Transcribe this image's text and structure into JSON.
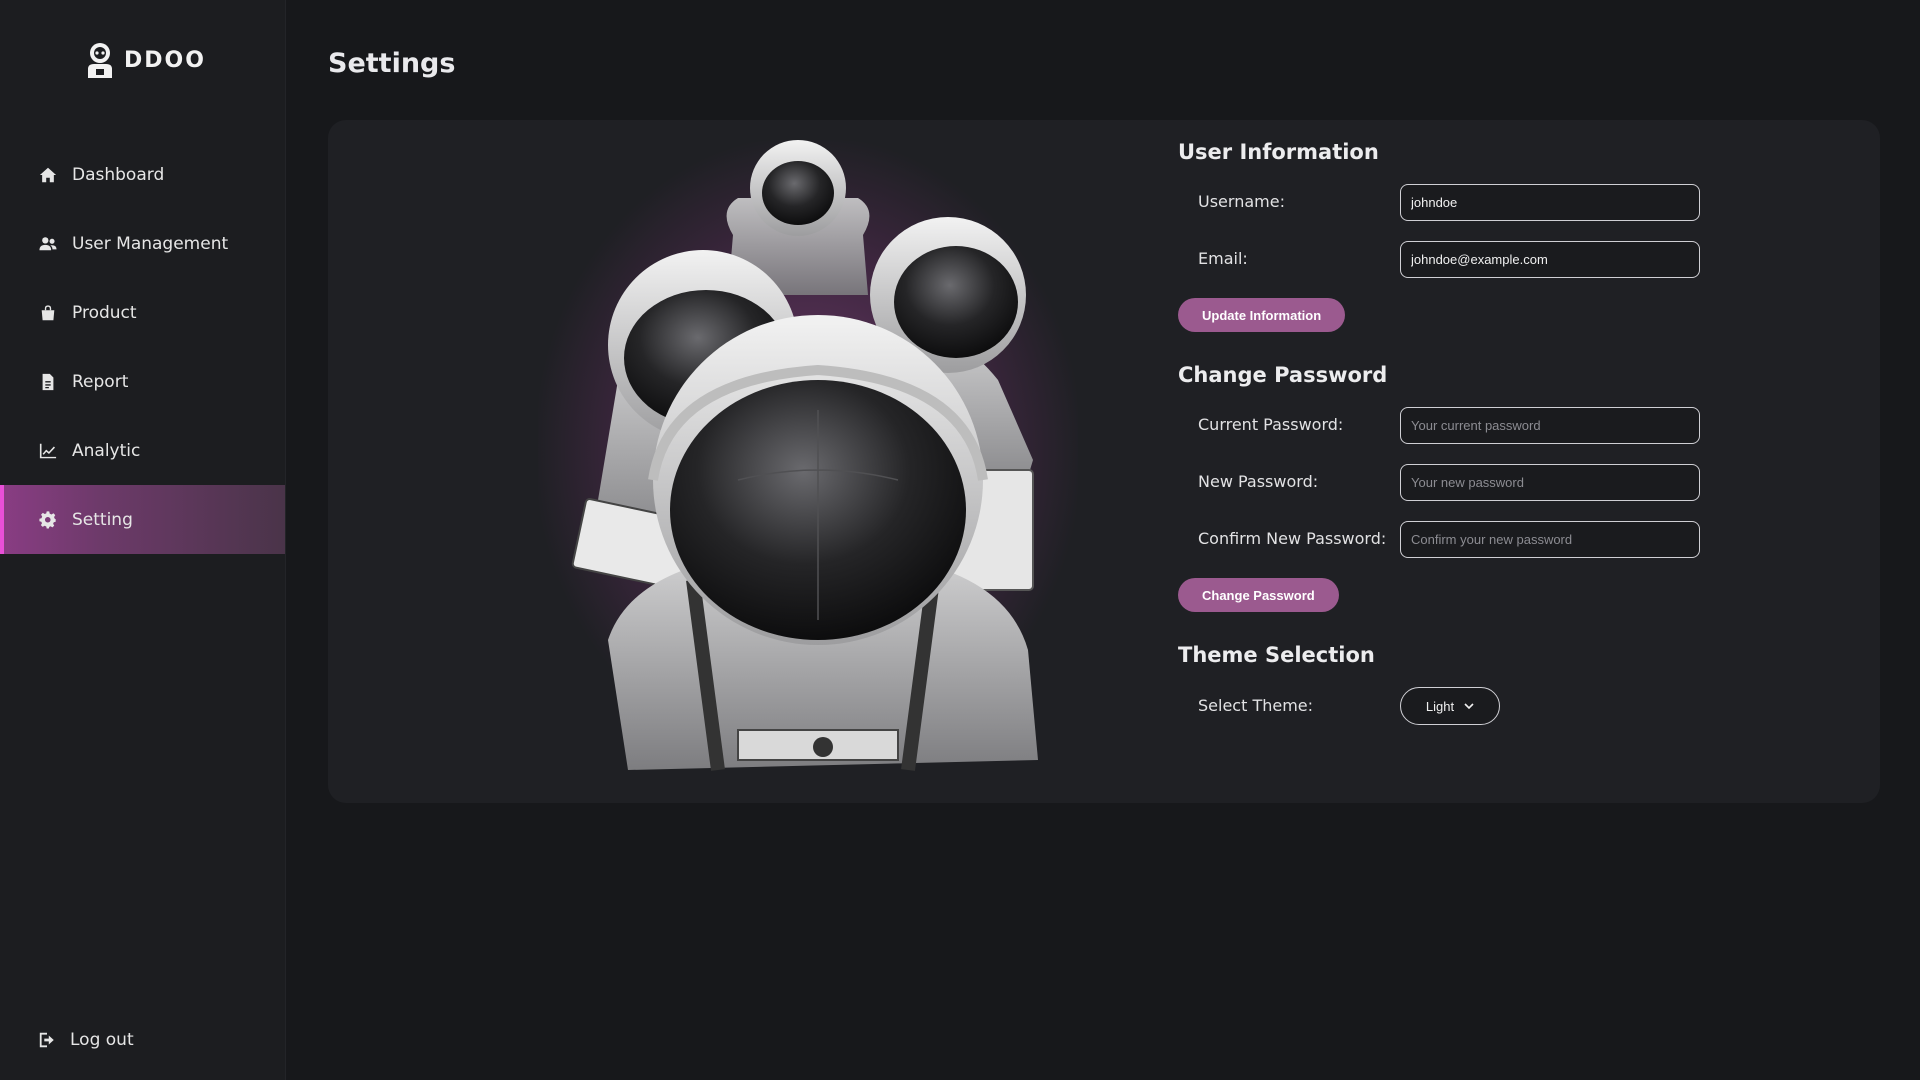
{
  "brand": {
    "name": "DDOO"
  },
  "sidebar": {
    "items": [
      {
        "label": "Dashboard",
        "icon": "home-icon"
      },
      {
        "label": "User Management",
        "icon": "users-icon"
      },
      {
        "label": "Product",
        "icon": "shopping-bag-icon"
      },
      {
        "label": "Report",
        "icon": "file-icon"
      },
      {
        "label": "Analytic",
        "icon": "line-chart-icon"
      },
      {
        "label": "Setting",
        "icon": "gear-icon",
        "active": true
      }
    ],
    "logout": {
      "label": "Log out",
      "icon": "logout-icon"
    }
  },
  "page": {
    "title": "Settings"
  },
  "user_info": {
    "title": "User Information",
    "username_label": "Username:",
    "username_value": "johndoe",
    "email_label": "Email:",
    "email_value": "johndoe@example.com",
    "update_button": "Update Information"
  },
  "password": {
    "title": "Change Password",
    "current_label": "Current Password:",
    "current_placeholder": "Your current password",
    "new_label": "New Password:",
    "new_placeholder": "Your new password",
    "confirm_label": "Confirm New Password:",
    "confirm_placeholder": "Confirm your new password",
    "change_button": "Change Password"
  },
  "theme": {
    "title": "Theme Selection",
    "select_label": "Select Theme:",
    "selected": "Light"
  },
  "colors": {
    "accent": "#9b5a8f",
    "active_nav_border": "#e94fd8",
    "background": "#17181b",
    "card": "#1f2024"
  }
}
